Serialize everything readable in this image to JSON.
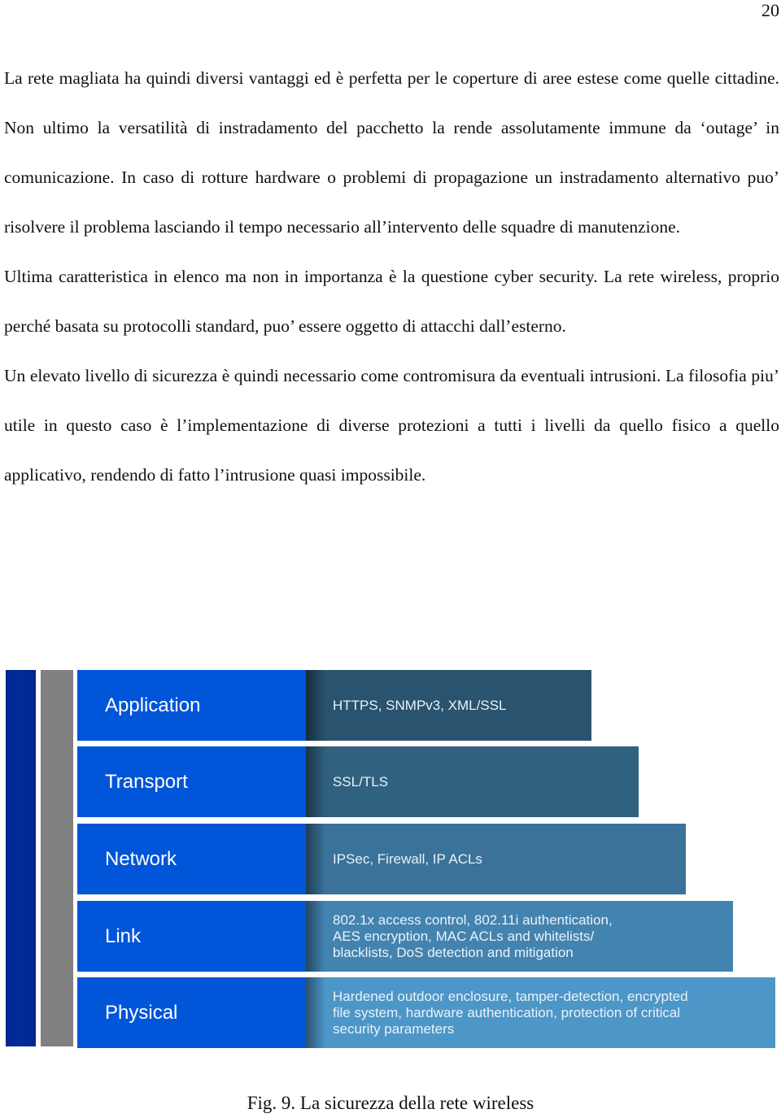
{
  "page_number": "20",
  "paragraphs": [
    "La rete magliata ha quindi diversi vantaggi ed è perfetta per le coperture di aree estese come quelle cittadine. Non ultimo la versatilità di instradamento del pacchetto la rende assolutamente immune da ‘outage’ in comunicazione. In caso di rotture hardware o problemi di propagazione un instradamento alternativo puo’ risolvere il problema lasciando il tempo necessario all’intervento delle squadre di manutenzione.",
    "Ultima caratteristica in elenco ma non in importanza è la questione cyber security. La rete wireless, proprio perché basata su protocolli standard, puo’ essere oggetto di attacchi dall’esterno.",
    "Un elevato livello di sicurezza è quindi necessario come contromisura da eventuali intrusioni. La filosofia piu’ utile in questo caso è l’implementazione di diverse protezioni a tutti i livelli da quello fisico a quello applicativo, rendendo di fatto l’intrusione quasi impossibile."
  ],
  "figure": {
    "layers": [
      {
        "label": "Application",
        "description": "HTTPS, SNMPv3,  XML/SSL",
        "color": "#29536e"
      },
      {
        "label": "Transport",
        "description": "SSL/TLS",
        "color": "#30617f"
      },
      {
        "label": "Network",
        "description": "IPSec, Firewall, IP ACLs",
        "color": "#3a7299"
      },
      {
        "label": "Link",
        "description": "802.1x access control, 802.11i authentication,\nAES encryption, MAC ACLs and whitelists/\nblacklists, DoS detection and mitigation",
        "color": "#4383b0"
      },
      {
        "label": "Physical",
        "description": "Hardened outdoor enclosure, tamper-detection, encrypted\nfile system, hardware authentication, protection of critical\nsecurity parameters",
        "color": "#4d96c8"
      }
    ],
    "caption": "Fig. 9.  La sicurezza della rete wireless"
  }
}
